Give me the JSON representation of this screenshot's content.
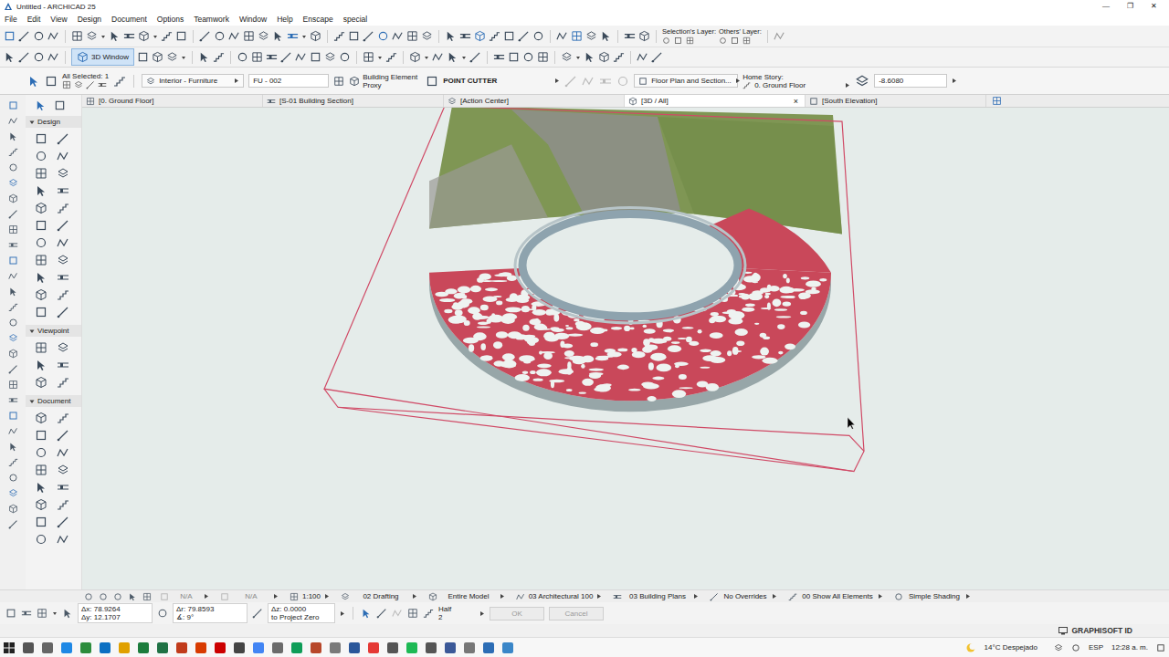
{
  "window": {
    "title": "Untitled - ARCHICAD 25",
    "controls": [
      "—",
      "❐",
      "✕"
    ]
  },
  "menu": [
    "File",
    "Edit",
    "View",
    "Design",
    "Document",
    "Options",
    "Teamwork",
    "Window",
    "Help",
    "Enscape",
    "special"
  ],
  "toolbar": {
    "selection_layer": "Selection's Layer:",
    "others_layer": "Others' Layer:",
    "window_button": {
      "label": "3D Window",
      "selected": true
    }
  },
  "info_box": {
    "all_selected": "All Selected: 1",
    "layer": "Interior - Furniture",
    "element_id": "FU - 002",
    "element_type": "Building Element Proxy",
    "object_name": "POINT CUTTER",
    "display": "Floor Plan and Section...",
    "home_story_label": "Home Story:",
    "home_story": "0. Ground Floor",
    "elevation": "-8.6080"
  },
  "tabs": [
    {
      "label": "[0. Ground Floor]",
      "selected": false
    },
    {
      "label": "[S-01 Building Section]",
      "selected": false
    },
    {
      "label": "[Action Center]",
      "selected": false
    },
    {
      "label": "[3D / All]",
      "selected": true,
      "close": "×"
    },
    {
      "label": "[South Elevation]",
      "selected": false
    }
  ],
  "toolbox": {
    "sections": [
      {
        "title": "Design",
        "expanded": true
      },
      {
        "title": "Viewpoint",
        "expanded": true
      },
      {
        "title": "Document",
        "expanded": true
      }
    ]
  },
  "status_bar": {
    "items": [
      {
        "text": "N/A",
        "disabled": true
      },
      {
        "text": "N/A",
        "disabled": true
      },
      {
        "text": "1:100",
        "disabled": false
      },
      {
        "text": "02 Drafting",
        "disabled": false
      },
      {
        "text": "Entire Model",
        "disabled": false
      },
      {
        "text": "03 Architectural 100",
        "disabled": false
      },
      {
        "text": "03 Building Plans",
        "disabled": false
      },
      {
        "text": "No Overrides",
        "disabled": false
      },
      {
        "text": "00 Show All Elements",
        "disabled": false
      },
      {
        "text": "Simple Shading",
        "disabled": false
      }
    ]
  },
  "coordinates": {
    "dx": "Δx: 78.9264",
    "dy": "Δy: 12.1707",
    "dr": "Δr: 79.8593",
    "angle": "∡: 9°",
    "dz": "Δz: 0.0000",
    "reference": "to Project Zero",
    "snap": "Half",
    "snap_value": "2"
  },
  "buttons": [
    {
      "label": "OK",
      "disabled": true
    },
    {
      "label": "Cancel",
      "disabled": true
    }
  ],
  "footer": {
    "brand": "GRAPHISOFT ID"
  },
  "taskbar": {
    "weather": "14°C Despejado",
    "language": "ESP",
    "time": "12:28 a. m."
  }
}
